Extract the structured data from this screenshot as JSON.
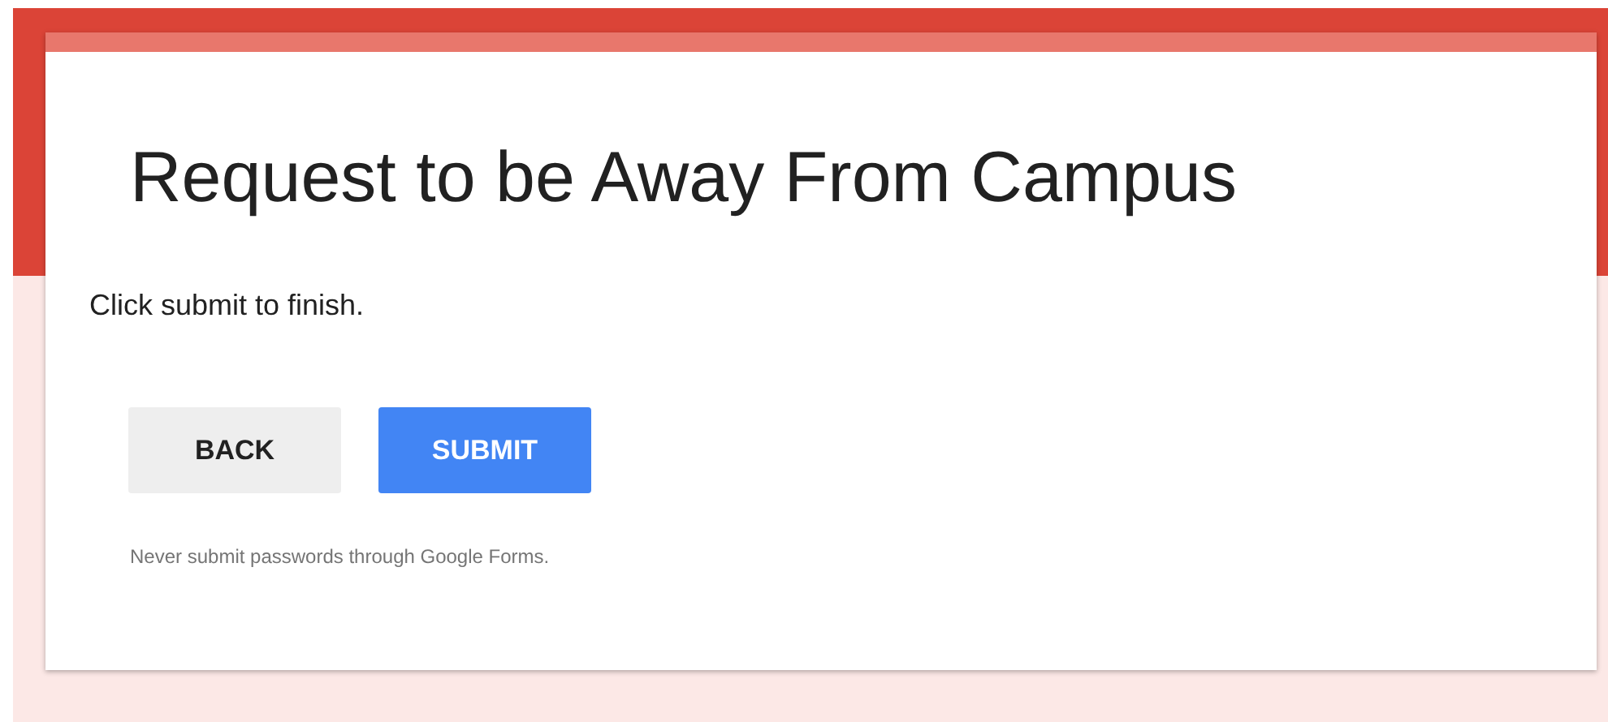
{
  "form": {
    "title": "Request to be Away From Campus",
    "message": "Click submit to finish.",
    "buttons": [
      {
        "label": "BACK",
        "kind": "secondary"
      },
      {
        "label": "SUBMIT",
        "kind": "primary"
      }
    ],
    "footer": "Never submit passwords through Google Forms."
  }
}
